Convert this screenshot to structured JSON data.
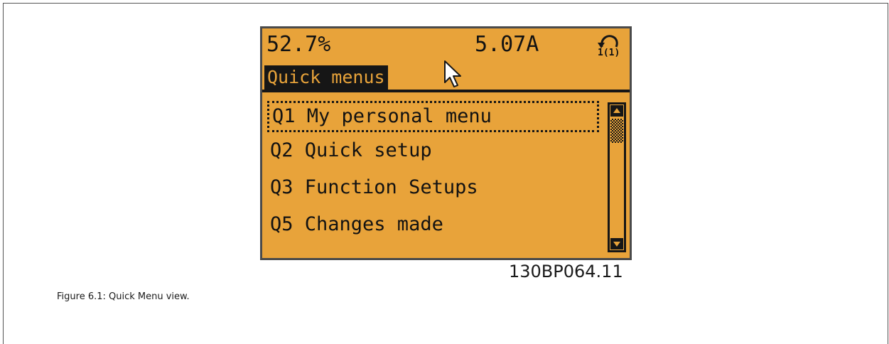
{
  "display": {
    "status": {
      "percent": "52.7%",
      "current": "5.07A",
      "setup_indicator": "1(1)"
    },
    "title": "Quick menus",
    "menu_items": [
      {
        "label": "Q1 My personal menu",
        "selected": true
      },
      {
        "label": "Q2 Quick setup",
        "selected": false
      },
      {
        "label": "Q3 Function Setups",
        "selected": false
      },
      {
        "label": "Q5 Changes made",
        "selected": false
      }
    ],
    "colors": {
      "background": "#e8a33a",
      "foreground": "#161616"
    }
  },
  "figure": {
    "code": "130BP064.11",
    "caption": "Figure 6.1: Quick Menu view."
  }
}
